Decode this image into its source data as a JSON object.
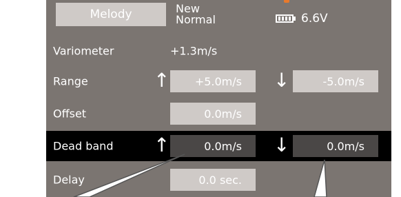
{
  "header": {
    "tab_label": "Melody",
    "mode_line1": "New",
    "mode_line2": "Normal",
    "battery_voltage": "6.6V"
  },
  "rows": {
    "variometer": {
      "label": "Variometer",
      "value": "+1.3m/s"
    },
    "range": {
      "label": "Range",
      "up_arrow": "↑",
      "up_value": "+5.0m/s",
      "down_arrow": "↓",
      "down_value": "-5.0m/s"
    },
    "offset": {
      "label": "Offset",
      "value": "0.0m/s"
    },
    "dead_band": {
      "label": "Dead band",
      "up_arrow": "↑",
      "up_value": "0.0m/s",
      "down_arrow": "↓",
      "down_value": "0.0m/s"
    },
    "delay": {
      "label": "Delay",
      "value": "0.0 sec."
    }
  },
  "colors": {
    "screen_bg": "#7b7571",
    "field_bg": "#cfcac7",
    "selected_row_bg": "#000000",
    "selected_field_bg": "#4a4746",
    "accent": "#e87a2c"
  }
}
